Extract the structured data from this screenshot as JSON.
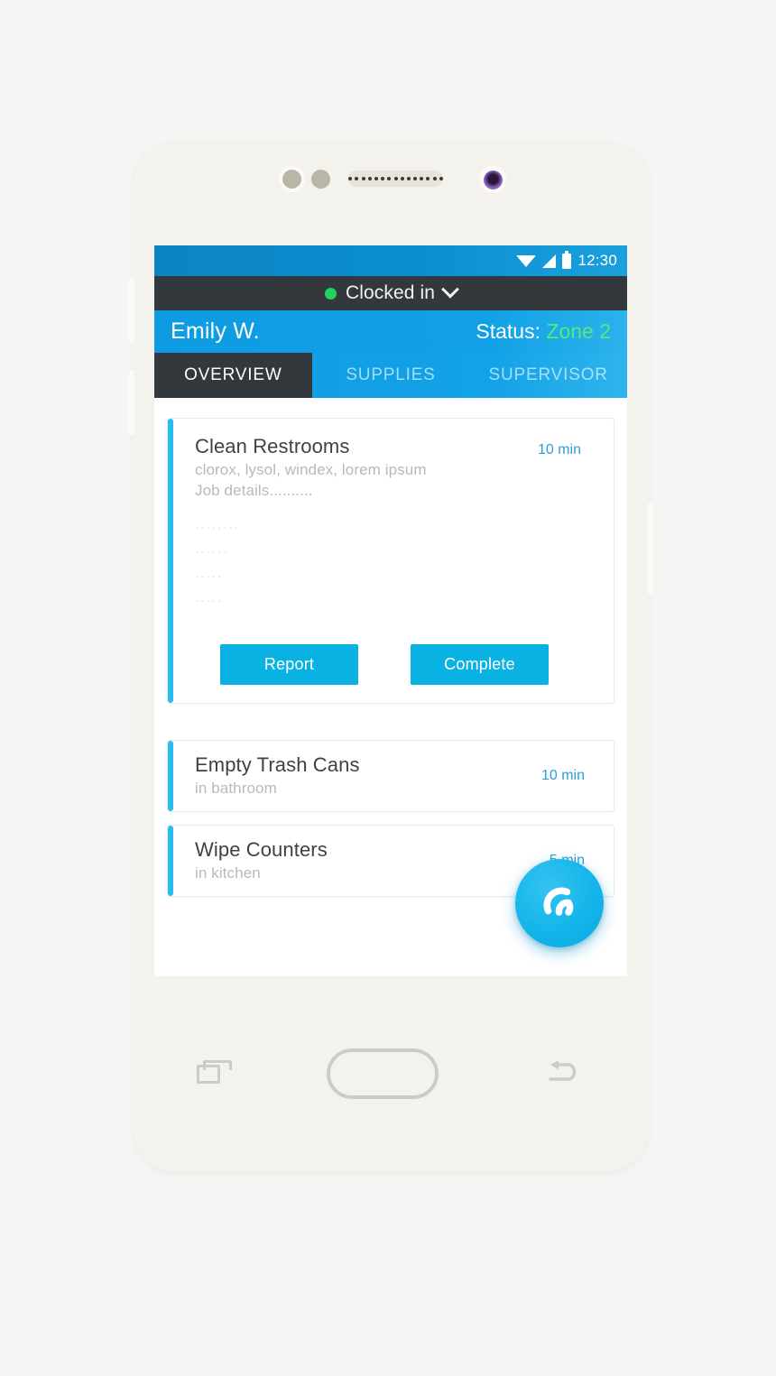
{
  "device": {
    "hardware": {
      "sensor_left": "proximity-sensor",
      "sensor_right": "light-sensor",
      "speaker": "earpiece-speaker",
      "camera": "front-camera",
      "volume_up": "volume-up-button",
      "volume_down": "volume-down-button",
      "power": "power-button"
    },
    "nav": {
      "recents_label": "recents-icon",
      "home_label": "home-icon",
      "back_label": "back-icon"
    }
  },
  "status_bar": {
    "time": "12:30",
    "icons": [
      "wifi-icon",
      "signal-icon",
      "battery-icon"
    ]
  },
  "clock_bar": {
    "label": "Clocked in",
    "dot_color": "#23d160",
    "chevron": "chevron-down-icon"
  },
  "user_bar": {
    "name": "Emily W.",
    "status_prefix": "Status:",
    "zone": "Zone 2",
    "zone_color": "#55ea7e"
  },
  "tabs": [
    {
      "label": "OVERVIEW",
      "active": true
    },
    {
      "label": "SUPPLIES",
      "active": false
    },
    {
      "label": "SUPERVISOR",
      "active": false
    }
  ],
  "colors": {
    "header_blue": "#0f9be2",
    "accent_cyan": "#29bdef",
    "button_cyan": "#09b2e3",
    "dark_bar": "#32383c",
    "time_text": "#2a9fe0"
  },
  "tasks": {
    "primary": {
      "title": "Clean Restrooms",
      "supplies": "clorox, lysol, windex, lorem ipsum",
      "details": "Job details..........",
      "time": "10 min",
      "placeholder_lines": [
        "........",
        "......",
        ".....",
        "....."
      ],
      "buttons": {
        "report": "Report",
        "complete": "Complete"
      }
    },
    "list": [
      {
        "title": "Empty Trash Cans",
        "location": "in bathroom",
        "time": "10 min"
      },
      {
        "title": "Wipe Counters",
        "location": "in kitchen",
        "time": "5 min"
      }
    ]
  },
  "fab": {
    "icon": "app-logo-icon"
  }
}
